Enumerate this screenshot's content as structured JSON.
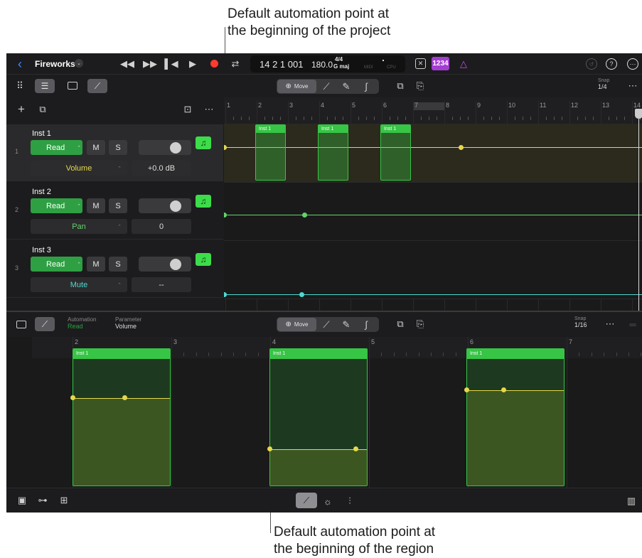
{
  "callouts": {
    "top_line1": "Default automation point at",
    "top_line2": "the beginning of the project",
    "bottom_line1": "Default automation point at",
    "bottom_line2": "the beginning of the region"
  },
  "header": {
    "project_name": "Fireworks",
    "lcd_position": "14 2 1 001",
    "lcd_tempo": "180.0",
    "lcd_signature": "4/4",
    "lcd_key": "G maj",
    "lcd_midi": "MIDI",
    "lcd_cpu": "CPU",
    "count_in": "1234"
  },
  "toolbar": {
    "move_label": "Move",
    "snap_label": "Snap",
    "snap_value": "1/4"
  },
  "ruler": [
    "1",
    "2",
    "3",
    "4",
    "5",
    "6",
    "7",
    "8",
    "9",
    "10",
    "11",
    "12",
    "13",
    "14"
  ],
  "tracks": [
    {
      "num": "1",
      "name": "Inst 1",
      "mode": "Read",
      "mute": "M",
      "solo": "S",
      "param": "Volume",
      "value": "+0.0 dB",
      "color": "#e6d84a"
    },
    {
      "num": "2",
      "name": "Inst 2",
      "mode": "Read",
      "mute": "M",
      "solo": "S",
      "param": "Pan",
      "value": "0",
      "color": "#62d36b"
    },
    {
      "num": "3",
      "name": "Inst 3",
      "mode": "Read",
      "mute": "M",
      "solo": "S",
      "param": "Mute",
      "value": "--",
      "color": "#4fd9d0"
    }
  ],
  "region_label": "Inst 1",
  "editor": {
    "automation_label": "Automation",
    "automation_value": "Read",
    "parameter_label": "Parameter",
    "parameter_value": "Volume",
    "move_label": "Move",
    "snap_label": "Snap",
    "snap_value": "1/16",
    "ruler": [
      "2",
      "3",
      "4",
      "5",
      "6",
      "7"
    ]
  },
  "colors": {
    "accent": "#2ea043",
    "region": "#37c545",
    "automation": "#e6d84a",
    "record": "#ff3b30",
    "purple": "#a43ed0"
  }
}
